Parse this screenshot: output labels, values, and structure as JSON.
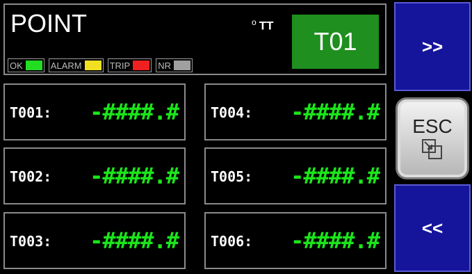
{
  "header": {
    "title": "POINT",
    "unit": "TT",
    "tag": "T01",
    "legend": [
      {
        "label": "OK",
        "color": "#22dd22"
      },
      {
        "label": "ALARM",
        "color": "#f0e020"
      },
      {
        "label": "TRIP",
        "color": "#ee2020"
      },
      {
        "label": "NR",
        "color": "#a0a0a0"
      }
    ]
  },
  "points": [
    {
      "label": "T001:",
      "value": "-####.#"
    },
    {
      "label": "T002:",
      "value": "-####.#"
    },
    {
      "label": "T003:",
      "value": "-####.#"
    },
    {
      "label": "T004:",
      "value": "-####.#"
    },
    {
      "label": "T005:",
      "value": "-####.#"
    },
    {
      "label": "T006:",
      "value": "-####.#"
    }
  ],
  "nav": {
    "next_label": ">>",
    "prev_label": "<<",
    "esc_label": "ESC"
  }
}
